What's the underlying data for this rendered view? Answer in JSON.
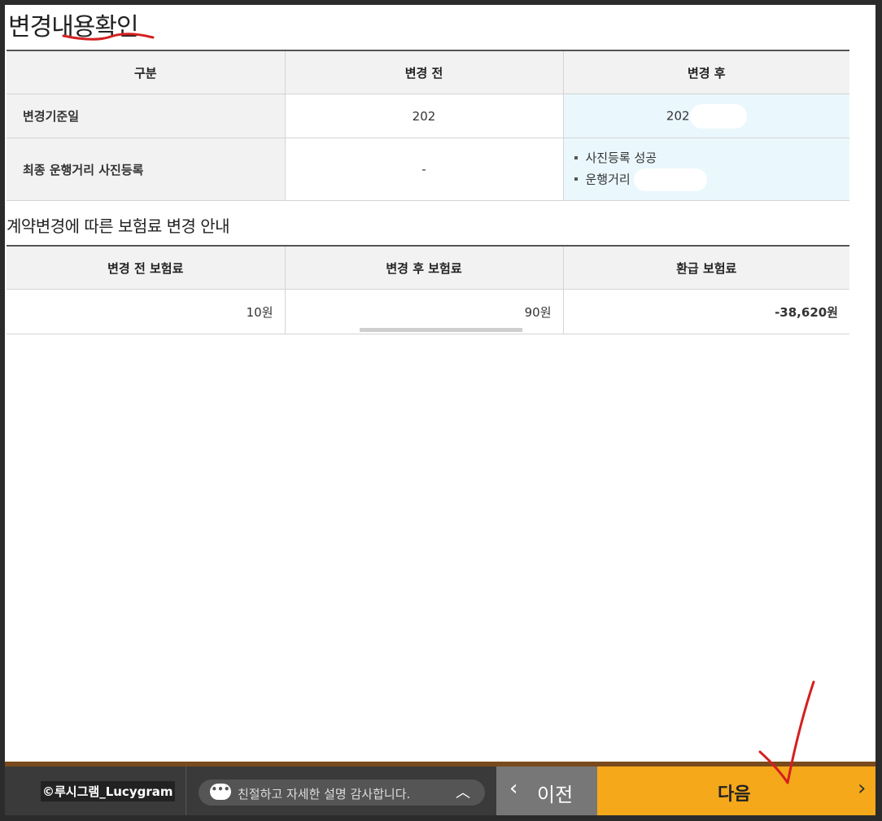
{
  "page_title": "변경내용확인",
  "change_table": {
    "headers": [
      "구분",
      "변경 전",
      "변경 후"
    ],
    "rows": {
      "base_date": {
        "label": "변경기준일",
        "before": "202",
        "after": "202"
      },
      "photo": {
        "label": "최종 운행거리 사진등록",
        "before": "-",
        "after_items": [
          "사진등록 성공",
          "운행거리"
        ]
      }
    }
  },
  "premium_section": {
    "title": "계약변경에 따른 보험료 변경 안내",
    "headers": [
      "변경 전 보험료",
      "변경 후 보험료",
      "환급 보험료"
    ],
    "values": {
      "before": "10원",
      "after": "90원",
      "refund": "-38,620원"
    }
  },
  "footer": {
    "credit": "©루시그램_Lucygram",
    "chat_text": "친절하고 자세한 설명 감사합니다.",
    "prev_label": "이전",
    "next_label": "다음"
  },
  "icons": {
    "chat": "chat-bubble-icon",
    "chevron_up": "chevron-up-icon",
    "prev": "chevron-left-icon",
    "next": "chevron-right-icon"
  },
  "colors": {
    "accent": "#f4a81a",
    "refund": "#e05b00",
    "highlight_cell": "#eaf8fd",
    "annotation": "#d42020"
  }
}
